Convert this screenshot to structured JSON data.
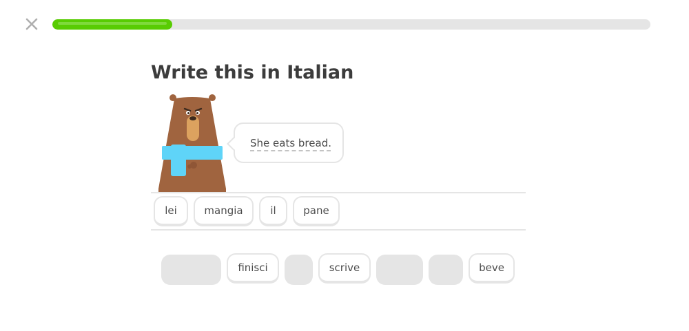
{
  "header": {
    "close_icon": "close-icon",
    "progress_fraction": 0.2
  },
  "challenge": {
    "title": "Write this in Italian",
    "prompt": "She eats bread.",
    "character": "bear-character"
  },
  "answer_tiles": [
    "lei",
    "mangia",
    "il",
    "pane"
  ],
  "word_bank": {
    "tiles": [
      "finisci",
      "scrive",
      "beve"
    ],
    "used_slot_count": 4
  },
  "colors": {
    "accent": "#58cc02",
    "track": "#e5e5e5",
    "text": "#3c3c3c",
    "bear_body": "#a0643f",
    "scarf": "#5fd4f8"
  }
}
